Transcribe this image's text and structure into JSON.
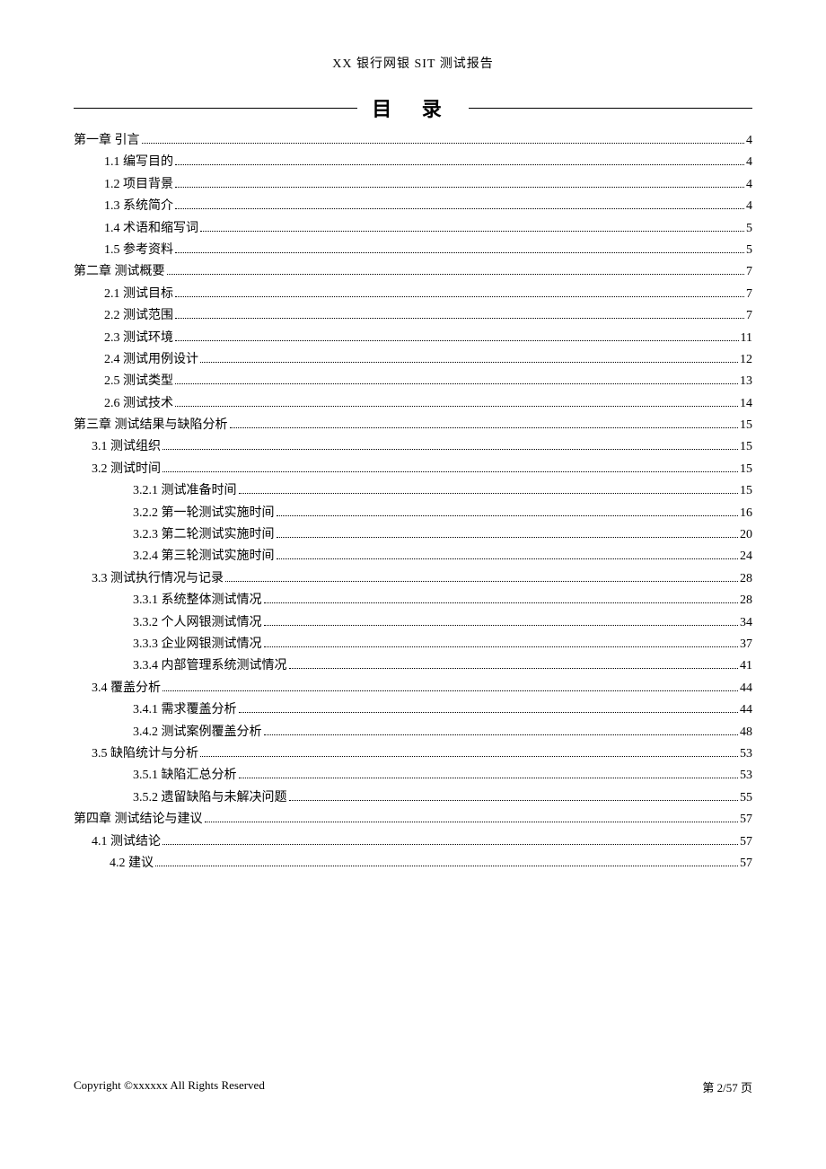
{
  "header": "XX 银行网银 SIT 测试报告",
  "tocTitle": "目   录",
  "toc": [
    {
      "indent": "lvl1",
      "label": "第一章  引言",
      "page": "4"
    },
    {
      "indent": "lvl2",
      "label": "1.1 编写目的",
      "page": "4"
    },
    {
      "indent": "lvl2",
      "label": "1.2 项目背景",
      "page": "4"
    },
    {
      "indent": "lvl2",
      "label": "1.3 系统简介",
      "page": "4"
    },
    {
      "indent": "lvl2",
      "label": "1.4 术语和缩写词",
      "page": "5"
    },
    {
      "indent": "lvl2",
      "label": "1.5 参考资料",
      "page": "5"
    },
    {
      "indent": "lvl1",
      "label": "第二章  测试概要",
      "page": "7"
    },
    {
      "indent": "lvl2",
      "label": "2.1 测试目标",
      "page": "7"
    },
    {
      "indent": "lvl2",
      "label": "2.2 测试范围",
      "page": "7"
    },
    {
      "indent": "lvl2",
      "label": "2.3 测试环境",
      "page": "11"
    },
    {
      "indent": "lvl2",
      "label": "2.4 测试用例设计",
      "page": "12"
    },
    {
      "indent": "lvl2",
      "label": "2.5 测试类型",
      "page": "13"
    },
    {
      "indent": "lvl2",
      "label": "2.6 测试技术",
      "page": "14"
    },
    {
      "indent": "lvl1",
      "label": "第三章  测试结果与缺陷分析",
      "page": "15"
    },
    {
      "indent": "lvl2b",
      "label": "3.1 测试组织",
      "page": "15"
    },
    {
      "indent": "lvl2b",
      "label": "3.2 测试时间",
      "page": "15"
    },
    {
      "indent": "lvl3",
      "label": "3.2.1 测试准备时间",
      "page": "15"
    },
    {
      "indent": "lvl3",
      "label": "3.2.2 第一轮测试实施时间",
      "page": "16"
    },
    {
      "indent": "lvl3",
      "label": "3.2.3 第二轮测试实施时间",
      "page": "20"
    },
    {
      "indent": "lvl3",
      "label": "3.2.4 第三轮测试实施时间",
      "page": "24"
    },
    {
      "indent": "lvl2b",
      "label": "3.3 测试执行情况与记录",
      "page": "28"
    },
    {
      "indent": "lvl3",
      "label": "3.3.1 系统整体测试情况",
      "page": "28"
    },
    {
      "indent": "lvl3",
      "label": "3.3.2 个人网银测试情况",
      "page": "34"
    },
    {
      "indent": "lvl3",
      "label": "3.3.3 企业网银测试情况",
      "page": "37"
    },
    {
      "indent": "lvl3",
      "label": "3.3.4 内部管理系统测试情况",
      "page": "41"
    },
    {
      "indent": "lvl2b",
      "label": "3.4 覆盖分析",
      "page": "44"
    },
    {
      "indent": "lvl3",
      "label": "3.4.1 需求覆盖分析",
      "page": "44"
    },
    {
      "indent": "lvl3",
      "label": "3.4.2 测试案例覆盖分析",
      "page": "48"
    },
    {
      "indent": "lvl2b",
      "label": "3.5 缺陷统计与分析",
      "page": "53"
    },
    {
      "indent": "lvl3",
      "label": "3.5.1 缺陷汇总分析",
      "page": "53"
    },
    {
      "indent": "lvl3",
      "label": "3.5.2 遗留缺陷与未解决问题",
      "page": "55"
    },
    {
      "indent": "lvl1",
      "label": "第四章  测试结论与建议",
      "page": "57"
    },
    {
      "indent": "lvl2b",
      "label": "4.1 测试结论",
      "page": "57"
    },
    {
      "indent": "lvl2c",
      "label": "4.2 建议",
      "page": "57"
    }
  ],
  "footer": {
    "left": "Copyright ©xxxxxx  All Rights Reserved",
    "right": "第 2/57 页"
  }
}
